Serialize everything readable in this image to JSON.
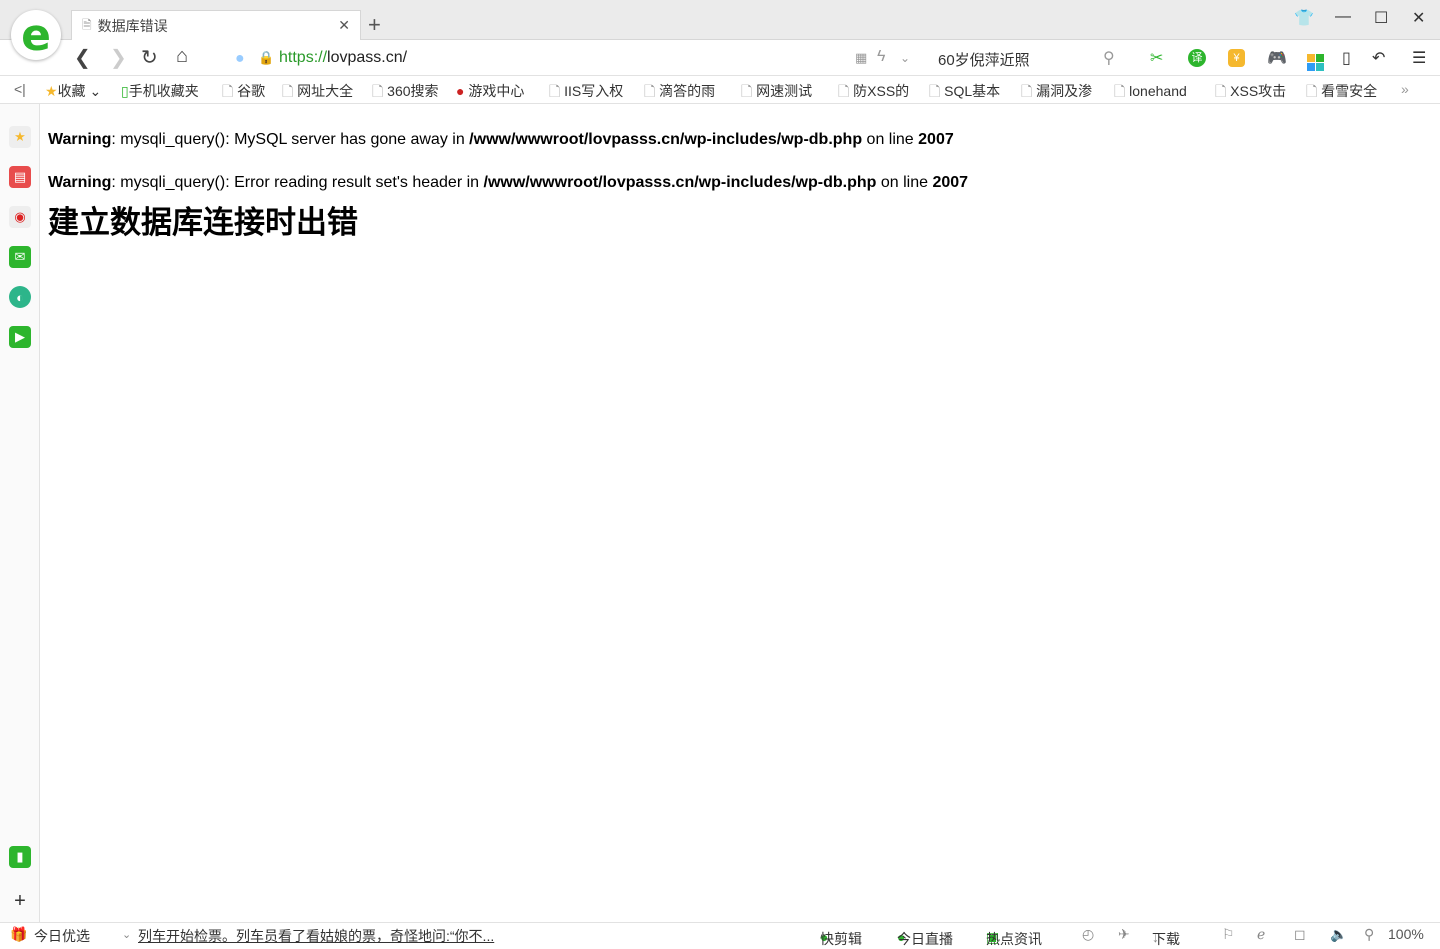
{
  "tab": {
    "title": "数据库错误"
  },
  "address": {
    "scheme": "https://",
    "host": "lovpass.cn/"
  },
  "search": {
    "value": "60岁倪萍近照"
  },
  "bookmarks": [
    "收藏",
    "手机收藏夹",
    "谷歌",
    "网址大全",
    "360搜索",
    "游戏中心",
    "IIS写入权",
    "滴答的雨",
    "网速测试",
    "防XSS的",
    "SQL基本",
    "漏洞及渗",
    "lonehand",
    "XSS攻击",
    "看雪安全"
  ],
  "page": {
    "warnings": [
      {
        "label": "Warning",
        "text": ": mysqli_query(): MySQL server has gone away in ",
        "path": "/www/wwwroot/lovpasss.cn/wp-includes/wp-db.php",
        "online": " on line ",
        "line": "2007"
      },
      {
        "label": "Warning",
        "text": ": mysqli_query(): Error reading result set's header in ",
        "path": "/www/wwwroot/lovpasss.cn/wp-includes/wp-db.php",
        "online": " on line ",
        "line": "2007"
      }
    ],
    "heading": "建立数据库连接时出错"
  },
  "status": {
    "today": "今日优选",
    "news": "列车开始检票。列车员看了看姑娘的票，奇怪地问:“你不...",
    "clip": "快剪辑",
    "live": "今日直播",
    "hot": "热点资讯",
    "download": "下载",
    "zoom": "100%"
  },
  "colors": {
    "accent": "#2db52d"
  }
}
